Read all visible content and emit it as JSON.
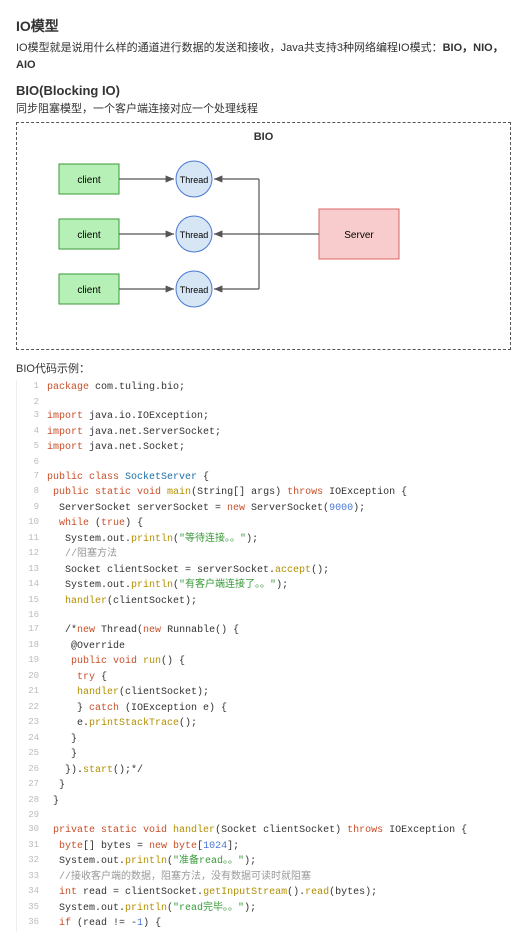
{
  "header": {
    "title": "IO模型",
    "desc_prefix": "IO模型就是说用什么样的通道进行数据的发送和接收，Java共支持3种网络编程IO模式：",
    "desc_bold": "BIO，NIO，AIO"
  },
  "bio_section": {
    "title": "BIO(Blocking IO)",
    "desc": "同步阻塞模型，一个客户端连接对应一个处理线程"
  },
  "diagram": {
    "title": "BIO",
    "client_label": "client",
    "thread_label": "Thread",
    "server_label": "Server"
  },
  "code_caption": "BIO代码示例：",
  "code_lines": [
    {
      "n": 1,
      "tokens": [
        [
          "kw",
          "package"
        ],
        [
          "plain",
          " com.tuling.bio;"
        ]
      ]
    },
    {
      "n": 2,
      "tokens": [
        [
          "plain",
          ""
        ]
      ]
    },
    {
      "n": 3,
      "tokens": [
        [
          "kw",
          "import"
        ],
        [
          "plain",
          " java.io.IOException;"
        ]
      ]
    },
    {
      "n": 4,
      "tokens": [
        [
          "kw",
          "import"
        ],
        [
          "plain",
          " java.net.ServerSocket;"
        ]
      ]
    },
    {
      "n": 5,
      "tokens": [
        [
          "kw",
          "import"
        ],
        [
          "plain",
          " java.net.Socket;"
        ]
      ]
    },
    {
      "n": 6,
      "tokens": [
        [
          "plain",
          ""
        ]
      ]
    },
    {
      "n": 7,
      "tokens": [
        [
          "kw",
          "public class "
        ],
        [
          "type",
          "SocketServer"
        ],
        [
          "plain",
          " {"
        ]
      ]
    },
    {
      "n": 8,
      "tokens": [
        [
          "plain",
          " "
        ],
        [
          "kw",
          "public static void "
        ],
        [
          "meth",
          "main"
        ],
        [
          "plain",
          "(String[] args) "
        ],
        [
          "kw",
          "throws"
        ],
        [
          "plain",
          " IOException {"
        ]
      ]
    },
    {
      "n": 9,
      "tokens": [
        [
          "plain",
          "  ServerSocket serverSocket = "
        ],
        [
          "kw",
          "new"
        ],
        [
          "plain",
          " ServerSocket("
        ],
        [
          "num",
          "9000"
        ],
        [
          "plain",
          ");"
        ]
      ]
    },
    {
      "n": 10,
      "tokens": [
        [
          "plain",
          "  "
        ],
        [
          "kw",
          "while"
        ],
        [
          "plain",
          " ("
        ],
        [
          "bool",
          "true"
        ],
        [
          "plain",
          ") {"
        ]
      ]
    },
    {
      "n": 11,
      "tokens": [
        [
          "plain",
          "   System.out."
        ],
        [
          "meth",
          "println"
        ],
        [
          "plain",
          "("
        ],
        [
          "str",
          "\"等待连接。。\""
        ],
        [
          "plain",
          ");"
        ]
      ]
    },
    {
      "n": 12,
      "tokens": [
        [
          "plain",
          "   "
        ],
        [
          "comm",
          "//阻塞方法"
        ]
      ]
    },
    {
      "n": 13,
      "tokens": [
        [
          "plain",
          "   Socket clientSocket = serverSocket."
        ],
        [
          "meth",
          "accept"
        ],
        [
          "plain",
          "();"
        ]
      ]
    },
    {
      "n": 14,
      "tokens": [
        [
          "plain",
          "   System.out."
        ],
        [
          "meth",
          "println"
        ],
        [
          "plain",
          "("
        ],
        [
          "str",
          "\"有客户端连接了。。\""
        ],
        [
          "plain",
          ");"
        ]
      ]
    },
    {
      "n": 15,
      "tokens": [
        [
          "plain",
          "   "
        ],
        [
          "meth",
          "handler"
        ],
        [
          "plain",
          "(clientSocket);"
        ]
      ]
    },
    {
      "n": 16,
      "tokens": [
        [
          "plain",
          ""
        ]
      ]
    },
    {
      "n": 17,
      "tokens": [
        [
          "plain",
          "   "
        ],
        [
          "comm",
          "/*new Thread(new Runnable() {"
        ]
      ]
    },
    {
      "n": 18,
      "tokens": [
        [
          "plain",
          "    "
        ],
        [
          "comm",
          "@Override"
        ]
      ]
    },
    {
      "n": 19,
      "tokens": [
        [
          "plain",
          "    "
        ],
        [
          "comm",
          "public void run() {"
        ]
      ]
    },
    {
      "n": 20,
      "tokens": [
        [
          "plain",
          "     "
        ],
        [
          "comm",
          "try {"
        ]
      ]
    },
    {
      "n": 21,
      "tokens": [
        [
          "plain",
          "     "
        ],
        [
          "comm",
          "handler(clientSocket);"
        ]
      ]
    },
    {
      "n": 22,
      "tokens": [
        [
          "plain",
          "     "
        ],
        [
          "comm",
          "} catch (IOException e) {"
        ]
      ]
    },
    {
      "n": 23,
      "tokens": [
        [
          "plain",
          "     "
        ],
        [
          "comm",
          "e.printStackTrace();"
        ]
      ]
    },
    {
      "n": 24,
      "tokens": [
        [
          "plain",
          "    "
        ],
        [
          "comm",
          "}"
        ]
      ]
    },
    {
      "n": 25,
      "tokens": [
        [
          "plain",
          "    "
        ],
        [
          "comm",
          "}"
        ]
      ]
    },
    {
      "n": 26,
      "tokens": [
        [
          "plain",
          "   "
        ],
        [
          "comm",
          "}).start();*/"
        ]
      ]
    },
    {
      "n": 27,
      "tokens": [
        [
          "plain",
          "  }"
        ]
      ]
    },
    {
      "n": 28,
      "tokens": [
        [
          "plain",
          " }"
        ]
      ]
    },
    {
      "n": 29,
      "tokens": [
        [
          "plain",
          ""
        ]
      ]
    },
    {
      "n": 30,
      "tokens": [
        [
          "plain",
          " "
        ],
        [
          "kw",
          "private static void "
        ],
        [
          "meth",
          "handler"
        ],
        [
          "plain",
          "(Socket clientSocket) "
        ],
        [
          "kw",
          "throws"
        ],
        [
          "plain",
          " IOException {"
        ]
      ]
    },
    {
      "n": 31,
      "tokens": [
        [
          "plain",
          "  "
        ],
        [
          "kw",
          "byte"
        ],
        [
          "plain",
          "[] bytes = "
        ],
        [
          "kw",
          "new byte"
        ],
        [
          "plain",
          "["
        ],
        [
          "num",
          "1024"
        ],
        [
          "plain",
          "];"
        ]
      ]
    },
    {
      "n": 32,
      "tokens": [
        [
          "plain",
          "  System.out."
        ],
        [
          "meth",
          "println"
        ],
        [
          "plain",
          "("
        ],
        [
          "str",
          "\"准备read。。\""
        ],
        [
          "plain",
          ");"
        ]
      ]
    },
    {
      "n": 33,
      "tokens": [
        [
          "plain",
          "  "
        ],
        [
          "comm",
          "//接收客户端的数据，阻塞方法，没有数据可读时就阻塞"
        ]
      ]
    },
    {
      "n": 34,
      "tokens": [
        [
          "plain",
          "  "
        ],
        [
          "kw",
          "int"
        ],
        [
          "plain",
          " read = clientSocket."
        ],
        [
          "meth",
          "getInputStream"
        ],
        [
          "plain",
          "()."
        ],
        [
          "meth",
          "read"
        ],
        [
          "plain",
          "(bytes);"
        ]
      ]
    },
    {
      "n": 35,
      "tokens": [
        [
          "plain",
          "  System.out."
        ],
        [
          "meth",
          "println"
        ],
        [
          "plain",
          "("
        ],
        [
          "str",
          "\"read完毕。。\""
        ],
        [
          "plain",
          ");"
        ]
      ]
    },
    {
      "n": 36,
      "tokens": [
        [
          "plain",
          "  "
        ],
        [
          "kw",
          "if"
        ],
        [
          "plain",
          " (read != -"
        ],
        [
          "num",
          "1"
        ],
        [
          "plain",
          ") {"
        ]
      ]
    }
  ],
  "comment_code_map": {
    "17": [
      [
        "plain",
        "   /*"
      ],
      [
        "kw",
        "new"
      ],
      [
        "plain",
        " Thread("
      ],
      [
        "kw",
        "new"
      ],
      [
        "plain",
        " Runnable() {"
      ]
    ],
    "18": [
      [
        "plain",
        "    @Override"
      ]
    ],
    "19": [
      [
        "plain",
        "    "
      ],
      [
        "kw",
        "public void "
      ],
      [
        "meth",
        "run"
      ],
      [
        "plain",
        "() {"
      ]
    ],
    "20": [
      [
        "plain",
        "     "
      ],
      [
        "kw",
        "try"
      ],
      [
        "plain",
        " {"
      ]
    ],
    "21": [
      [
        "plain",
        "     "
      ],
      [
        "meth",
        "handler"
      ],
      [
        "plain",
        "(clientSocket);"
      ]
    ],
    "22": [
      [
        "plain",
        "     } "
      ],
      [
        "kw",
        "catch"
      ],
      [
        "plain",
        " (IOException e) {"
      ]
    ],
    "23": [
      [
        "plain",
        "     e."
      ],
      [
        "meth",
        "printStackTrace"
      ],
      [
        "plain",
        "();"
      ]
    ],
    "24": [
      [
        "plain",
        "    }"
      ]
    ],
    "25": [
      [
        "plain",
        "    }"
      ]
    ],
    "26": [
      [
        "plain",
        "   })."
      ],
      [
        "meth",
        "start"
      ],
      [
        "plain",
        "();*/"
      ]
    ]
  }
}
